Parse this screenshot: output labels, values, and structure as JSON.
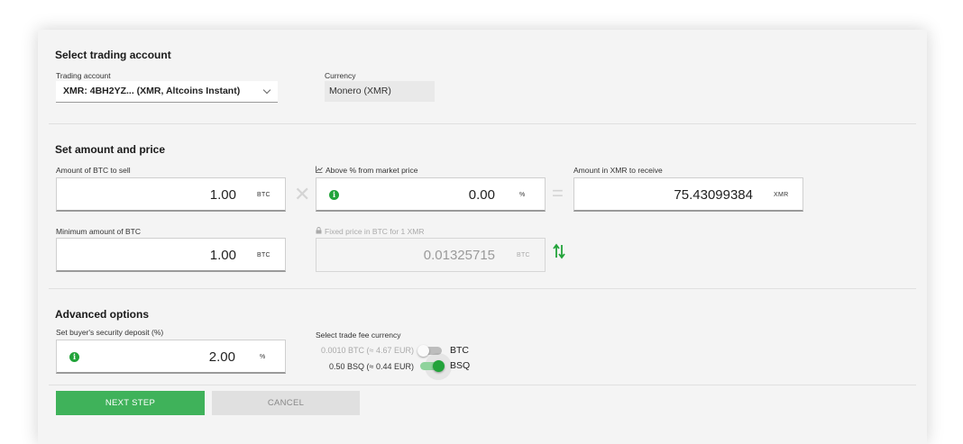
{
  "account_section": {
    "title": "Select trading account",
    "trading_account_label": "Trading account",
    "trading_account_value": "XMR: 4BH2YZ... (XMR, Altcoins Instant)",
    "currency_label": "Currency",
    "currency_value": "Monero (XMR)"
  },
  "amount_section": {
    "title": "Set amount and price",
    "amount_label": "Amount of BTC to sell",
    "amount_value": "1.00",
    "amount_unit": "BTC",
    "above_label": "Above % from market price",
    "above_value": "0.00",
    "above_unit": "%",
    "receive_label": "Amount in XMR to receive",
    "receive_value": "75.43099384",
    "receive_unit": "XMR",
    "min_label": "Minimum amount of BTC",
    "min_value": "1.00",
    "min_unit": "BTC",
    "fixed_label": "Fixed price in BTC for 1 XMR",
    "fixed_value": "0.01325715",
    "fixed_unit": "BTC"
  },
  "advanced_section": {
    "title": "Advanced options",
    "deposit_label": "Set buyer's security deposit (%)",
    "deposit_value": "2.00",
    "deposit_unit": "%",
    "fee_label": "Select trade fee currency",
    "fee_options": [
      {
        "amount": "0.0010 BTC (≈ 4.67 EUR)",
        "currency": "BTC",
        "selected": false
      },
      {
        "amount": "0.50 BSQ (≈ 0.44 EUR)",
        "currency": "BSQ",
        "selected": true
      }
    ]
  },
  "buttons": {
    "next_step": "NEXT STEP",
    "cancel": "CANCEL"
  },
  "colors": {
    "accent_green": "#3fb25a",
    "icon_green": "#22a33a"
  },
  "icons": {
    "times": "✕",
    "equals": "="
  }
}
